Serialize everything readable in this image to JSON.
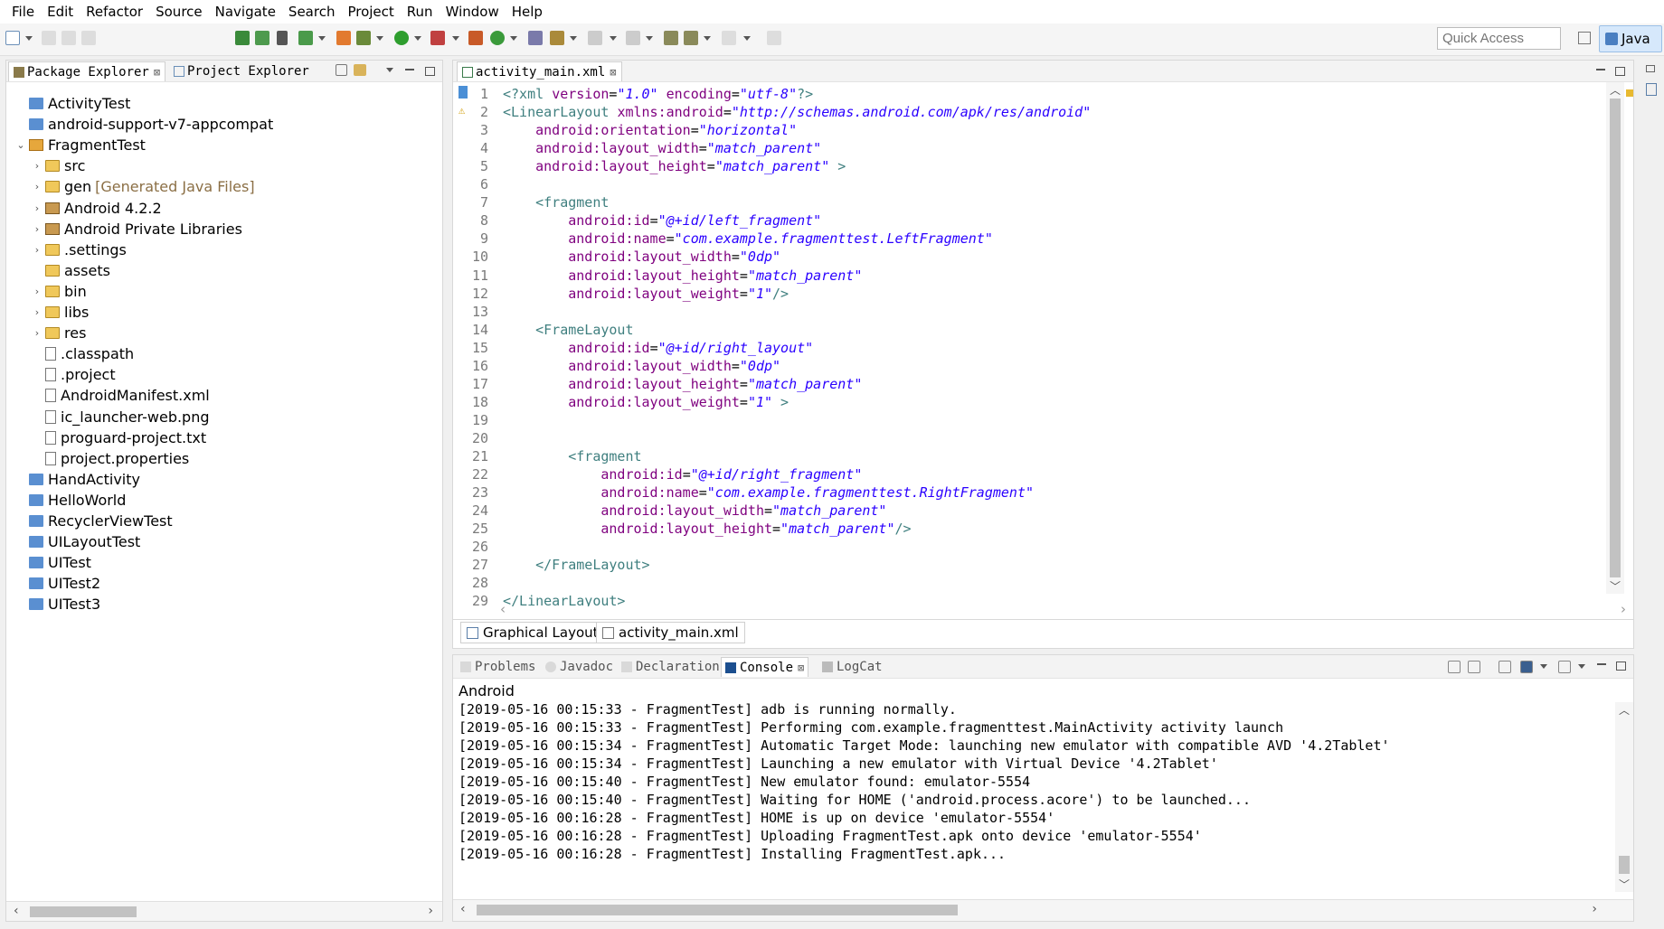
{
  "menu": [
    "File",
    "Edit",
    "Refactor",
    "Source",
    "Navigate",
    "Search",
    "Project",
    "Run",
    "Window",
    "Help"
  ],
  "toolbar": {
    "quick_access_placeholder": "Quick Access",
    "perspective_label": "Java"
  },
  "package_explorer": {
    "tabs": [
      {
        "label": "Package Explorer",
        "active": true
      },
      {
        "label": "Project Explorer",
        "active": false
      }
    ],
    "tree": [
      {
        "label": "ActivityTest",
        "level": 0,
        "expander": "",
        "icon": "project-icon"
      },
      {
        "label": "android-support-v7-appcompat",
        "level": 0,
        "expander": "",
        "icon": "project-icon"
      },
      {
        "label": "FragmentTest",
        "level": 0,
        "expander": "v",
        "icon": "android-project-icon"
      },
      {
        "label": "src",
        "level": 1,
        "expander": ">",
        "icon": "source-folder-icon"
      },
      {
        "label": "gen",
        "decoration": "[Generated Java Files]",
        "level": 1,
        "expander": ">",
        "icon": "source-folder-icon"
      },
      {
        "label": "Android 4.2.2",
        "level": 1,
        "expander": ">",
        "icon": "library-icon"
      },
      {
        "label": "Android Private Libraries",
        "level": 1,
        "expander": ">",
        "icon": "library-icon"
      },
      {
        "label": ".settings",
        "level": 1,
        "expander": ">",
        "icon": "folder-icon"
      },
      {
        "label": "assets",
        "level": 1,
        "expander": "",
        "icon": "folder-icon"
      },
      {
        "label": "bin",
        "level": 1,
        "expander": ">",
        "icon": "folder-icon"
      },
      {
        "label": "libs",
        "level": 1,
        "expander": ">",
        "icon": "folder-icon"
      },
      {
        "label": "res",
        "level": 1,
        "expander": ">",
        "icon": "folder-icon"
      },
      {
        "label": ".classpath",
        "level": 1,
        "expander": "",
        "icon": "xml-file-icon"
      },
      {
        "label": ".project",
        "level": 1,
        "expander": "",
        "icon": "xml-file-icon"
      },
      {
        "label": "AndroidManifest.xml",
        "level": 1,
        "expander": "",
        "icon": "manifest-file-icon"
      },
      {
        "label": "ic_launcher-web.png",
        "level": 1,
        "expander": "",
        "icon": "file-icon"
      },
      {
        "label": "proguard-project.txt",
        "level": 1,
        "expander": "",
        "icon": "file-icon"
      },
      {
        "label": "project.properties",
        "level": 1,
        "expander": "",
        "icon": "file-icon"
      },
      {
        "label": "HandActivity",
        "level": 0,
        "expander": "",
        "icon": "project-icon"
      },
      {
        "label": "HelloWorld",
        "level": 0,
        "expander": "",
        "icon": "project-icon"
      },
      {
        "label": "RecyclerViewTest",
        "level": 0,
        "expander": "",
        "icon": "project-icon"
      },
      {
        "label": "UILayoutTest",
        "level": 0,
        "expander": "",
        "icon": "project-icon"
      },
      {
        "label": "UITest",
        "level": 0,
        "expander": "",
        "icon": "project-icon"
      },
      {
        "label": "UITest2",
        "level": 0,
        "expander": "",
        "icon": "project-icon"
      },
      {
        "label": "UITest3",
        "level": 0,
        "expander": "",
        "icon": "project-icon"
      }
    ]
  },
  "editor": {
    "tab_label": "activity_main.xml",
    "lines": [
      [
        [
          "pi",
          "<?xml "
        ],
        [
          "attr",
          "version"
        ],
        [
          "",
          "="
        ],
        [
          "str",
          "\"1.0\""
        ],
        [
          "attr",
          " encoding"
        ],
        [
          "",
          "="
        ],
        [
          "str",
          "\"utf-8\""
        ],
        [
          "pi",
          "?>"
        ]
      ],
      [
        [
          "tag",
          "<LinearLayout "
        ],
        [
          "attr",
          "xmlns:android"
        ],
        [
          "",
          "="
        ],
        [
          "str",
          "\"http://schemas.android.com/apk/res/android\""
        ]
      ],
      [
        [
          "attr",
          "    android:orientation"
        ],
        [
          "",
          "="
        ],
        [
          "str",
          "\"horizontal\""
        ]
      ],
      [
        [
          "attr",
          "    android:layout_width"
        ],
        [
          "",
          "="
        ],
        [
          "str",
          "\"match_parent\""
        ]
      ],
      [
        [
          "attr",
          "    android:layout_height"
        ],
        [
          "",
          "="
        ],
        [
          "str",
          "\"match_parent\""
        ],
        [
          "tag",
          " >"
        ]
      ],
      [],
      [
        [
          "tag",
          "    <fragment"
        ]
      ],
      [
        [
          "attr",
          "        android:id"
        ],
        [
          "",
          "="
        ],
        [
          "str",
          "\"@+id/left_fragment\""
        ]
      ],
      [
        [
          "attr",
          "        android:name"
        ],
        [
          "",
          "="
        ],
        [
          "str",
          "\"com.example.fragmenttest.LeftFragment\""
        ]
      ],
      [
        [
          "attr",
          "        android:layout_width"
        ],
        [
          "",
          "="
        ],
        [
          "str",
          "\"0dp\""
        ]
      ],
      [
        [
          "attr",
          "        android:layout_height"
        ],
        [
          "",
          "="
        ],
        [
          "str",
          "\"match_parent\""
        ]
      ],
      [
        [
          "attr",
          "        android:layout_weight"
        ],
        [
          "",
          "="
        ],
        [
          "str",
          "\"1\""
        ],
        [
          "tag",
          "/>"
        ]
      ],
      [],
      [
        [
          "tag",
          "    <FrameLayout"
        ]
      ],
      [
        [
          "attr",
          "        android:id"
        ],
        [
          "",
          "="
        ],
        [
          "str",
          "\"@+id/right_layout\""
        ]
      ],
      [
        [
          "attr",
          "        android:layout_width"
        ],
        [
          "",
          "="
        ],
        [
          "str",
          "\"0dp\""
        ]
      ],
      [
        [
          "attr",
          "        android:layout_height"
        ],
        [
          "",
          "="
        ],
        [
          "str",
          "\"match_parent\""
        ]
      ],
      [
        [
          "attr",
          "        android:layout_weight"
        ],
        [
          "",
          "="
        ],
        [
          "str",
          "\"1\""
        ],
        [
          "tag",
          " >"
        ]
      ],
      [],
      [],
      [
        [
          "tag",
          "        <fragment"
        ]
      ],
      [
        [
          "attr",
          "            android:id"
        ],
        [
          "",
          "="
        ],
        [
          "str",
          "\"@+id/right_fragment\""
        ]
      ],
      [
        [
          "attr",
          "            android:name"
        ],
        [
          "",
          "="
        ],
        [
          "str",
          "\"com.example.fragmenttest.RightFragment\""
        ]
      ],
      [
        [
          "attr",
          "            android:layout_width"
        ],
        [
          "",
          "="
        ],
        [
          "str",
          "\"match_parent\""
        ]
      ],
      [
        [
          "attr",
          "            android:layout_height"
        ],
        [
          "",
          "="
        ],
        [
          "str",
          "\"match_parent\""
        ],
        [
          "tag",
          "/>"
        ]
      ],
      [],
      [
        [
          "tag",
          "    </FrameLayout>"
        ]
      ],
      [],
      [
        [
          "tag",
          "</LinearLayout>"
        ]
      ]
    ],
    "bottom_tabs": [
      {
        "label": "Graphical Layout",
        "active": false
      },
      {
        "label": "activity_main.xml",
        "active": true
      }
    ]
  },
  "console": {
    "tabs": [
      {
        "label": "Problems",
        "active": false
      },
      {
        "label": "Javadoc",
        "active": false
      },
      {
        "label": "Declaration",
        "active": false
      },
      {
        "label": "Console",
        "active": true
      },
      {
        "label": "LogCat",
        "active": false
      }
    ],
    "title": "Android",
    "lines": [
      "[2019-05-16 00:15:33 - FragmentTest] adb is running normally.",
      "[2019-05-16 00:15:33 - FragmentTest] Performing com.example.fragmenttest.MainActivity activity launch",
      "[2019-05-16 00:15:34 - FragmentTest] Automatic Target Mode: launching new emulator with compatible AVD '4.2Tablet'",
      "[2019-05-16 00:15:34 - FragmentTest] Launching a new emulator with Virtual Device '4.2Tablet'",
      "[2019-05-16 00:15:40 - FragmentTest] New emulator found: emulator-5554",
      "[2019-05-16 00:15:40 - FragmentTest] Waiting for HOME ('android.process.acore') to be launched...",
      "[2019-05-16 00:16:28 - FragmentTest] HOME is up on device 'emulator-5554'",
      "[2019-05-16 00:16:28 - FragmentTest] Uploading FragmentTest.apk onto device 'emulator-5554'",
      "[2019-05-16 00:16:28 - FragmentTest] Installing FragmentTest.apk..."
    ]
  },
  "colors": {
    "xml_tag": "#3f7f7f",
    "xml_attr": "#7f007f",
    "xml_string": "#2a00ff",
    "accent": "#d6e8fb"
  }
}
